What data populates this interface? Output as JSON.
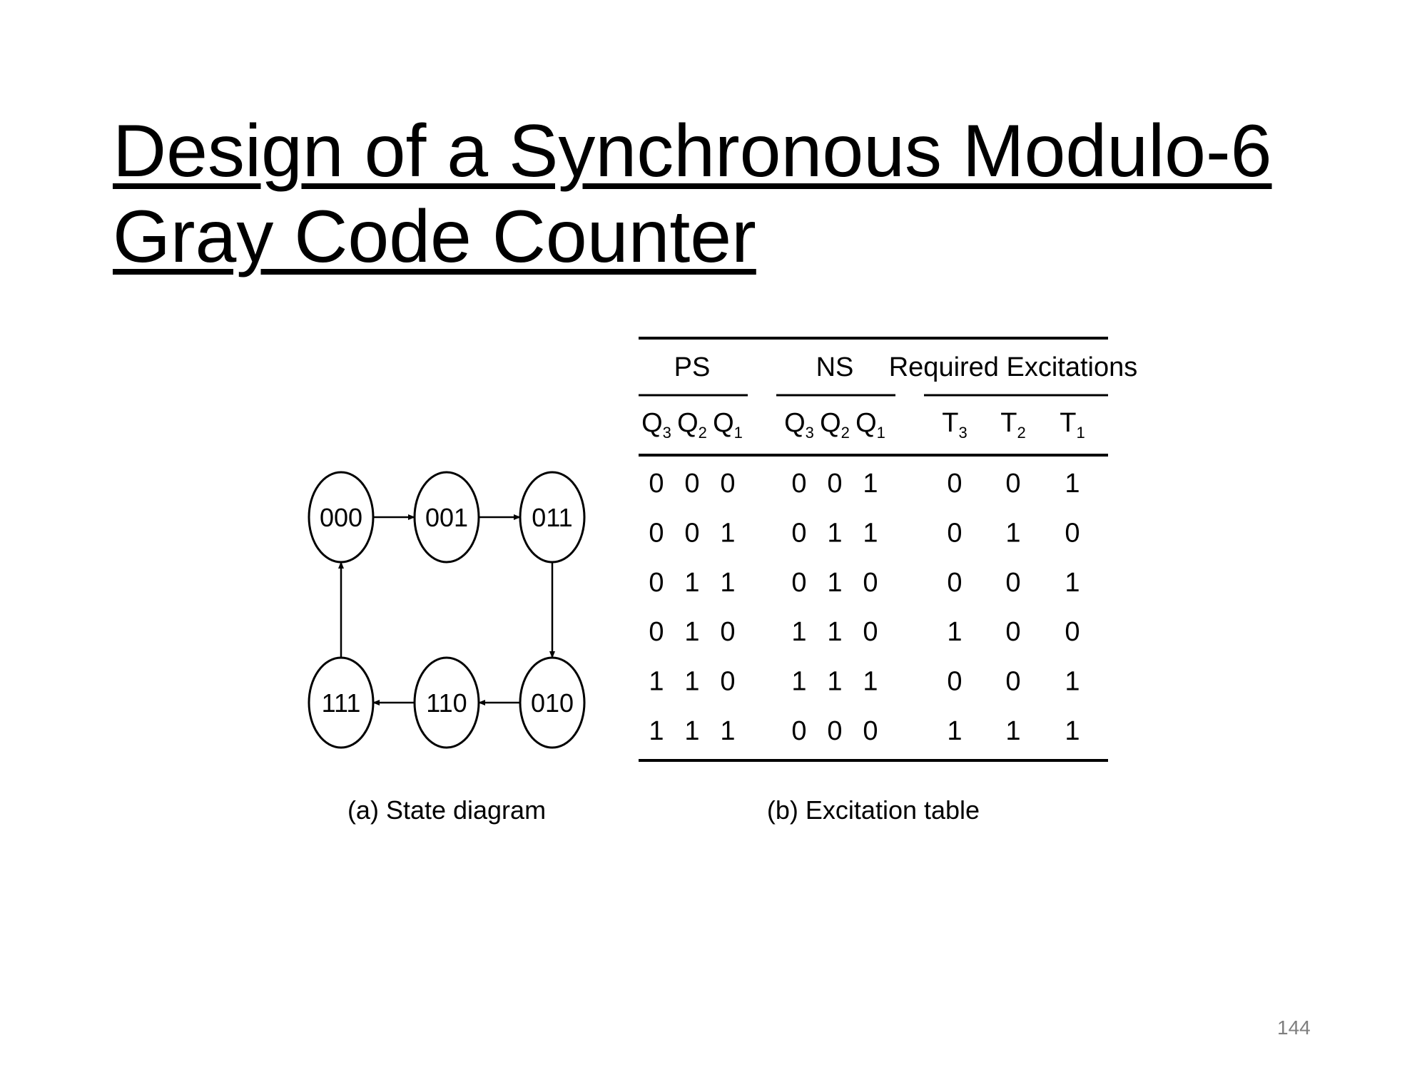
{
  "slide": {
    "title_line1": "Design of a Synchronous Modulo-6",
    "title_line2": "Gray Code Counter",
    "page_number": "144"
  },
  "state_diagram": {
    "caption": "(a) State diagram",
    "states": [
      "000",
      "001",
      "011",
      "010",
      "110",
      "111"
    ],
    "transitions": [
      [
        "000",
        "001"
      ],
      [
        "001",
        "011"
      ],
      [
        "011",
        "010"
      ],
      [
        "010",
        "110"
      ],
      [
        "110",
        "111"
      ],
      [
        "111",
        "000"
      ]
    ]
  },
  "excitation_table": {
    "caption": "(b) Excitation table",
    "groups": [
      "PS",
      "NS",
      "Required Excitations"
    ],
    "columns": [
      {
        "base": "Q",
        "sub": "3"
      },
      {
        "base": "Q",
        "sub": "2"
      },
      {
        "base": "Q",
        "sub": "1"
      },
      {
        "base": "Q",
        "sub": "3"
      },
      {
        "base": "Q",
        "sub": "2"
      },
      {
        "base": "Q",
        "sub": "1"
      },
      {
        "base": "T",
        "sub": "3"
      },
      {
        "base": "T",
        "sub": "2"
      },
      {
        "base": "T",
        "sub": "1"
      }
    ],
    "rows": [
      [
        "0",
        "0",
        "0",
        "0",
        "0",
        "1",
        "0",
        "0",
        "1"
      ],
      [
        "0",
        "0",
        "1",
        "0",
        "1",
        "1",
        "0",
        "1",
        "0"
      ],
      [
        "0",
        "1",
        "1",
        "0",
        "1",
        "0",
        "0",
        "0",
        "1"
      ],
      [
        "0",
        "1",
        "0",
        "1",
        "1",
        "0",
        "1",
        "0",
        "0"
      ],
      [
        "1",
        "1",
        "0",
        "1",
        "1",
        "1",
        "0",
        "0",
        "1"
      ],
      [
        "1",
        "1",
        "1",
        "0",
        "0",
        "0",
        "1",
        "1",
        "1"
      ]
    ]
  }
}
